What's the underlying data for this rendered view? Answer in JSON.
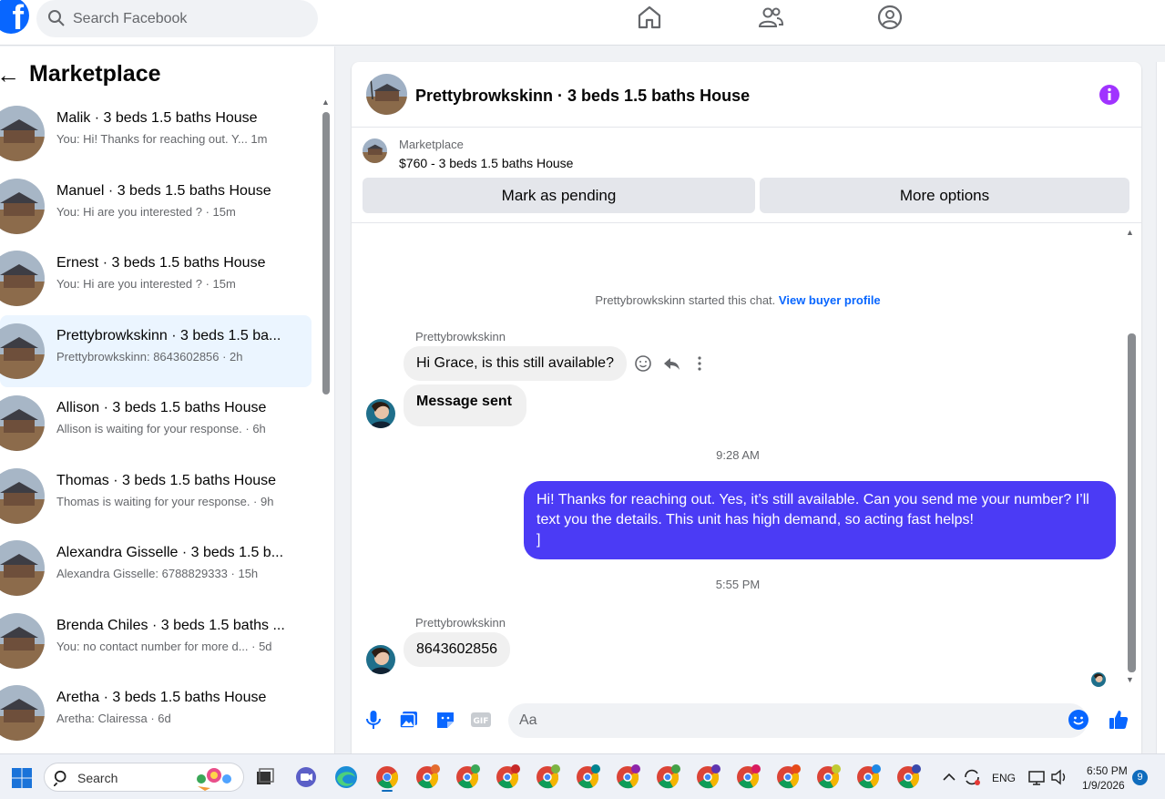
{
  "topbar": {
    "search_placeholder": "Search Facebook",
    "nav_icons": [
      "home-icon",
      "friends-icon",
      "profile-icon"
    ]
  },
  "sidebar": {
    "title": "Marketplace",
    "conversations": [
      {
        "title": "Malik · 3 beds 1.5 baths House",
        "preview": "You: Hi! Thanks for reaching out. Y...   1m"
      },
      {
        "title": "Manuel · 3 beds 1.5 baths House",
        "preview": "You: Hi are you interested ? · 15m"
      },
      {
        "title": "Ernest · 3 beds 1.5 baths House",
        "preview": "You: Hi are you interested ? · 15m"
      },
      {
        "title": "Prettybrowkskinn · 3 beds 1.5 ba...",
        "preview": "Prettybrowkskinn: 8643602856 · 2h"
      },
      {
        "title": "Allison · 3 beds 1.5 baths House",
        "preview": "Allison is waiting for your response. · 6h"
      },
      {
        "title": "Thomas · 3 beds 1.5 baths House",
        "preview": "Thomas is waiting for your response. · 9h"
      },
      {
        "title": "Alexandra Gisselle · 3 beds 1.5 b...",
        "preview": "Alexandra Gisselle: 6788829333 · 15h"
      },
      {
        "title": "Brenda Chiles · 3 beds 1.5 baths ...",
        "preview": "You: no contact number for more d... · 5d"
      },
      {
        "title": "Aretha · 3 beds 1.5 baths House",
        "preview": "Aretha: Clairessa · 6d"
      }
    ]
  },
  "chat": {
    "title": "Prettybrowkskinn · 3 beds 1.5 baths House",
    "listing_source": "Marketplace",
    "listing_desc": "$760 - 3 beds 1.5 baths House",
    "mark_pending_label": "Mark as pending",
    "more_options_label": "More options",
    "started_text": "Prettybrowkskinn started this chat.",
    "buyer_profile_link": "View buyer profile",
    "sender_name": "Prettybrowkskinn",
    "msg1": "Hi Grace, is this still available?",
    "msg2": "Message sent",
    "time1": "9:28 AM",
    "msg_out": "Hi! Thanks for reaching out. Yes, it’s still available. Can you send me your number? I’ll text you the details. This unit has high demand, so acting fast helps!\n]",
    "time2": "5:55 PM",
    "msg3": "8643602856",
    "composer_placeholder": "Aa"
  },
  "taskbar": {
    "search_label": "Search",
    "lang": "ENG",
    "time": "6:50 PM",
    "date": "1/9/2026",
    "notification_count": "9"
  },
  "colors": {
    "accent": "#0866ff",
    "outgoing_bubble": "#4b3bf5",
    "info_icon": "#a033ff"
  }
}
